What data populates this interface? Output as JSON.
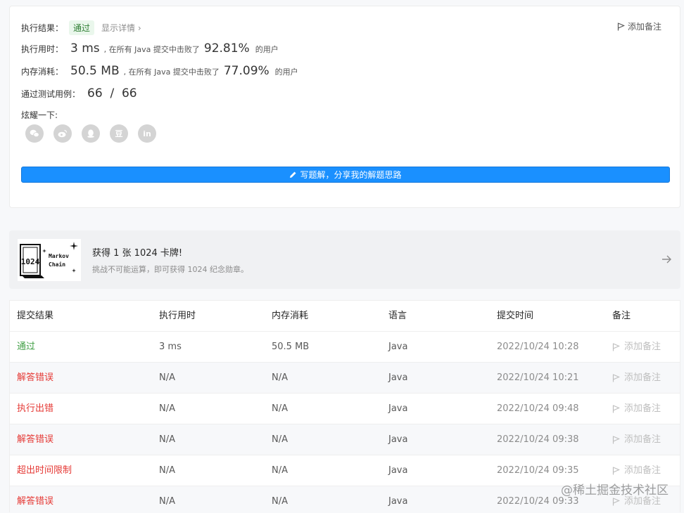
{
  "result": {
    "status_label": "执行结果：",
    "status_value": "通过",
    "detail_link": "显示详情",
    "detail_chevron": "›",
    "add_note": "添加备注",
    "runtime_label": "执行用时：",
    "runtime_value": "3 ms",
    "runtime_text": ", 在所有 Java 提交中击败了",
    "runtime_pct": "92.81%",
    "runtime_suffix": "的用户",
    "memory_label": "内存消耗：",
    "memory_value": "50.5 MB",
    "memory_text": ", 在所有 Java 提交中击败了",
    "memory_pct": "77.09%",
    "memory_suffix": "的用户",
    "tests_label": "通过测试用例：",
    "tests_value": "66  /  66",
    "share_label": "炫耀一下:",
    "share_icons": [
      "wechat-icon",
      "weibo-icon",
      "qq-icon",
      "douban-icon",
      "linkedin-icon"
    ],
    "douban_glyph": "豆",
    "linkedin_glyph": "in",
    "solution_button": "写题解，分享我的解题思路"
  },
  "banner": {
    "title": "获得 1 张 1024 卡牌!",
    "subtitle": "挑战不可能运算，即可获得 1024 纪念勋章。",
    "card_text_1": "Markov",
    "card_text_2": "Chain",
    "card_mark": "1024"
  },
  "table": {
    "headers": [
      "提交结果",
      "执行用时",
      "内存消耗",
      "语言",
      "提交时间",
      "备注"
    ],
    "rows": [
      {
        "status": "通过",
        "ok": true,
        "time": "3 ms",
        "memory": "50.5 MB",
        "lang": "Java",
        "date": "2022/10/24 10:28",
        "note": "添加备注"
      },
      {
        "status": "解答错误",
        "ok": false,
        "time": "N/A",
        "memory": "N/A",
        "lang": "Java",
        "date": "2022/10/24 10:21",
        "note": "添加备注"
      },
      {
        "status": "执行出错",
        "ok": false,
        "time": "N/A",
        "memory": "N/A",
        "lang": "Java",
        "date": "2022/10/24 09:48",
        "note": "添加备注"
      },
      {
        "status": "解答错误",
        "ok": false,
        "time": "N/A",
        "memory": "N/A",
        "lang": "Java",
        "date": "2022/10/24 09:38",
        "note": "添加备注"
      },
      {
        "status": "超出时间限制",
        "ok": false,
        "time": "N/A",
        "memory": "N/A",
        "lang": "Java",
        "date": "2022/10/24 09:35",
        "note": "添加备注"
      },
      {
        "status": "解答错误",
        "ok": false,
        "time": "N/A",
        "memory": "N/A",
        "lang": "Java",
        "date": "2022/10/24 09:33",
        "note": "添加备注"
      }
    ]
  },
  "watermark": "@稀土掘金技术社区",
  "colors": {
    "accent": "#1a90ff",
    "pass": "#43a047",
    "error": "#e53935"
  }
}
